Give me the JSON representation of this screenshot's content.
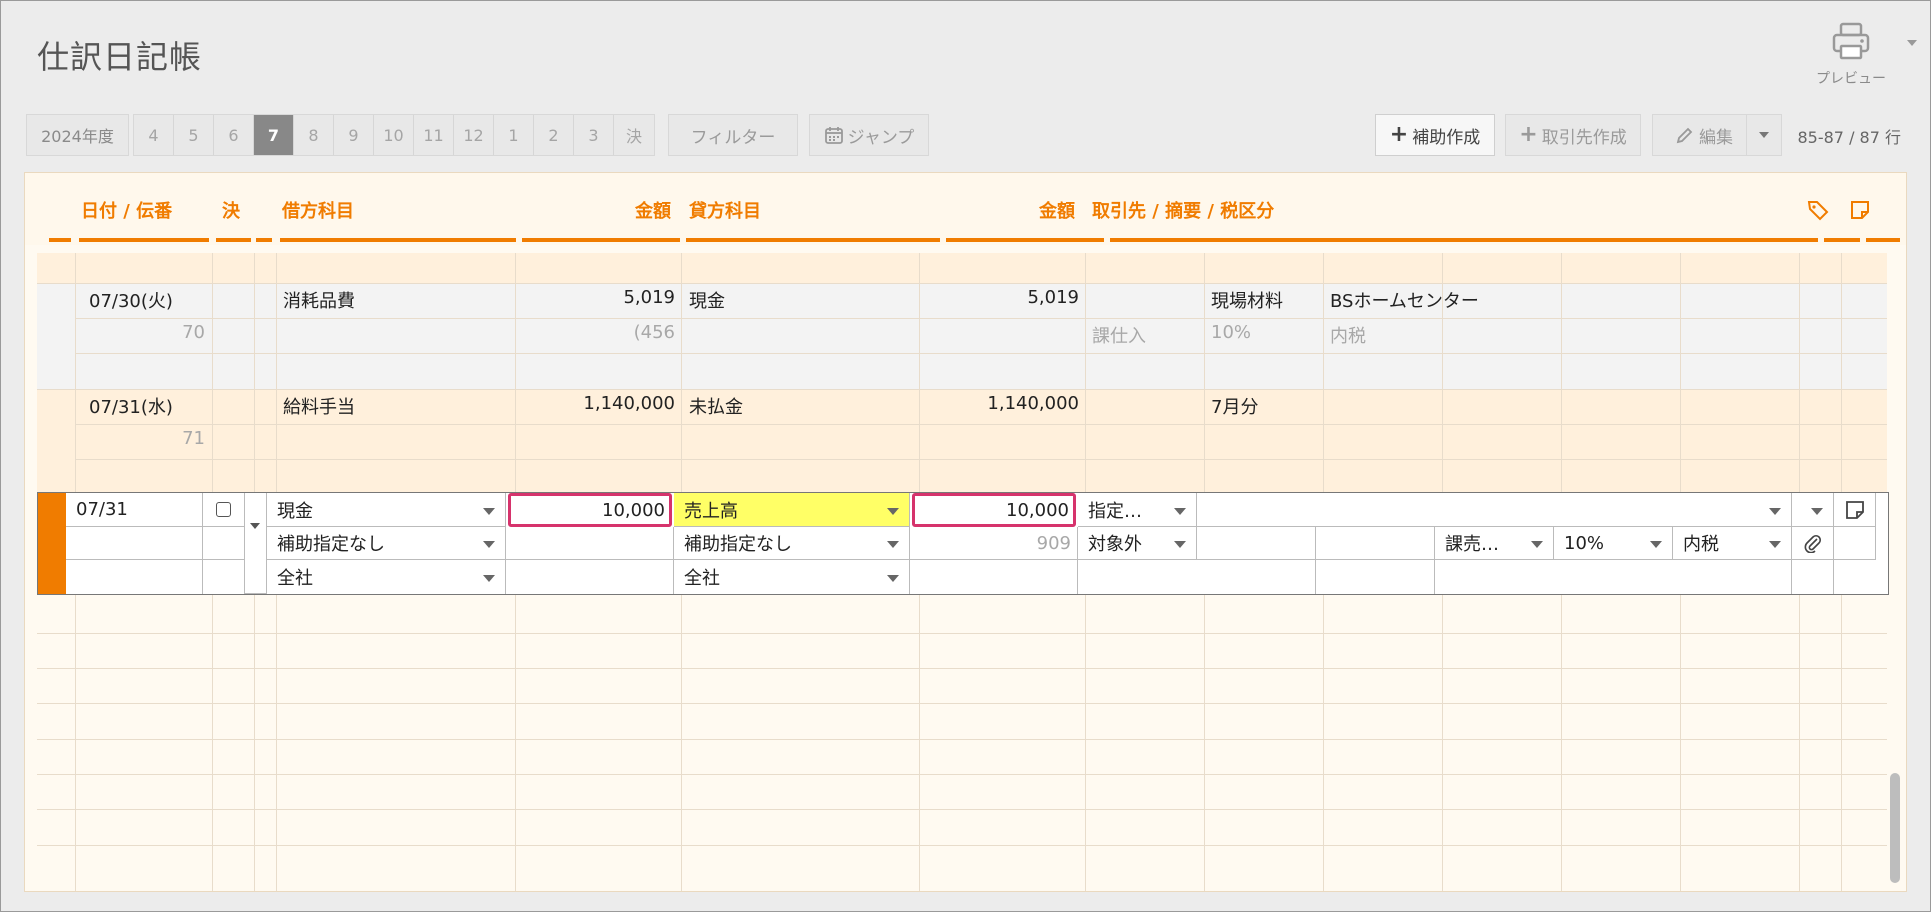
{
  "title": "仕訳日記帳",
  "preview_label": "プレビュー",
  "toolbar": {
    "year_label": "2024年度",
    "months": [
      "4",
      "5",
      "6",
      "7",
      "8",
      "9",
      "10",
      "11",
      "12",
      "1",
      "2",
      "3",
      "決"
    ],
    "active_month": "7",
    "filter_label": "フィルター",
    "jump_label": "ジャンプ",
    "add_sub_label": "補助作成",
    "add_partner_label": "取引先作成",
    "edit_label": "編集",
    "row_count": "85-87 / 87 行"
  },
  "columns": {
    "date": "日付 / 伝番",
    "settle": "決",
    "debit_account": "借方科目",
    "debit_amount": "金額",
    "credit_account": "貸方科目",
    "credit_amount": "金額",
    "partner": "取引先 / 摘要 / 税区分"
  },
  "entries": [
    {
      "date": "07/30(火)",
      "no": "70",
      "debit_account": "消耗品費",
      "debit_amount": "5,019",
      "debit_tax": "(456",
      "credit_account": "現金",
      "credit_amount": "5,019",
      "memo": "現場材料",
      "partner": "BSホームセンター",
      "tax_category": "課仕入",
      "tax_rate": "10%",
      "tax_type": "内税"
    },
    {
      "date": "07/31(水)",
      "no": "71",
      "debit_account": "給料手当",
      "debit_amount": "1,140,000",
      "credit_account": "未払金",
      "credit_amount": "1,140,000",
      "memo": "7月分"
    }
  ],
  "input_row": {
    "date": "07/31",
    "debit_account": "現金",
    "debit_sub": "補助指定なし",
    "debit_dept": "全社",
    "debit_amount": "10,000",
    "credit_account": "売上高",
    "credit_sub": "補助指定なし",
    "credit_dept": "全社",
    "credit_amount": "10,000",
    "credit_tax": "909",
    "partner_select": "指定…",
    "tax_scope": "対象外",
    "tax_category": "課売…",
    "tax_rate": "10%",
    "tax_type": "内税"
  },
  "colors": {
    "accent": "#f07c00",
    "highlight": "#d6336c",
    "yellow": "#ffff66"
  }
}
